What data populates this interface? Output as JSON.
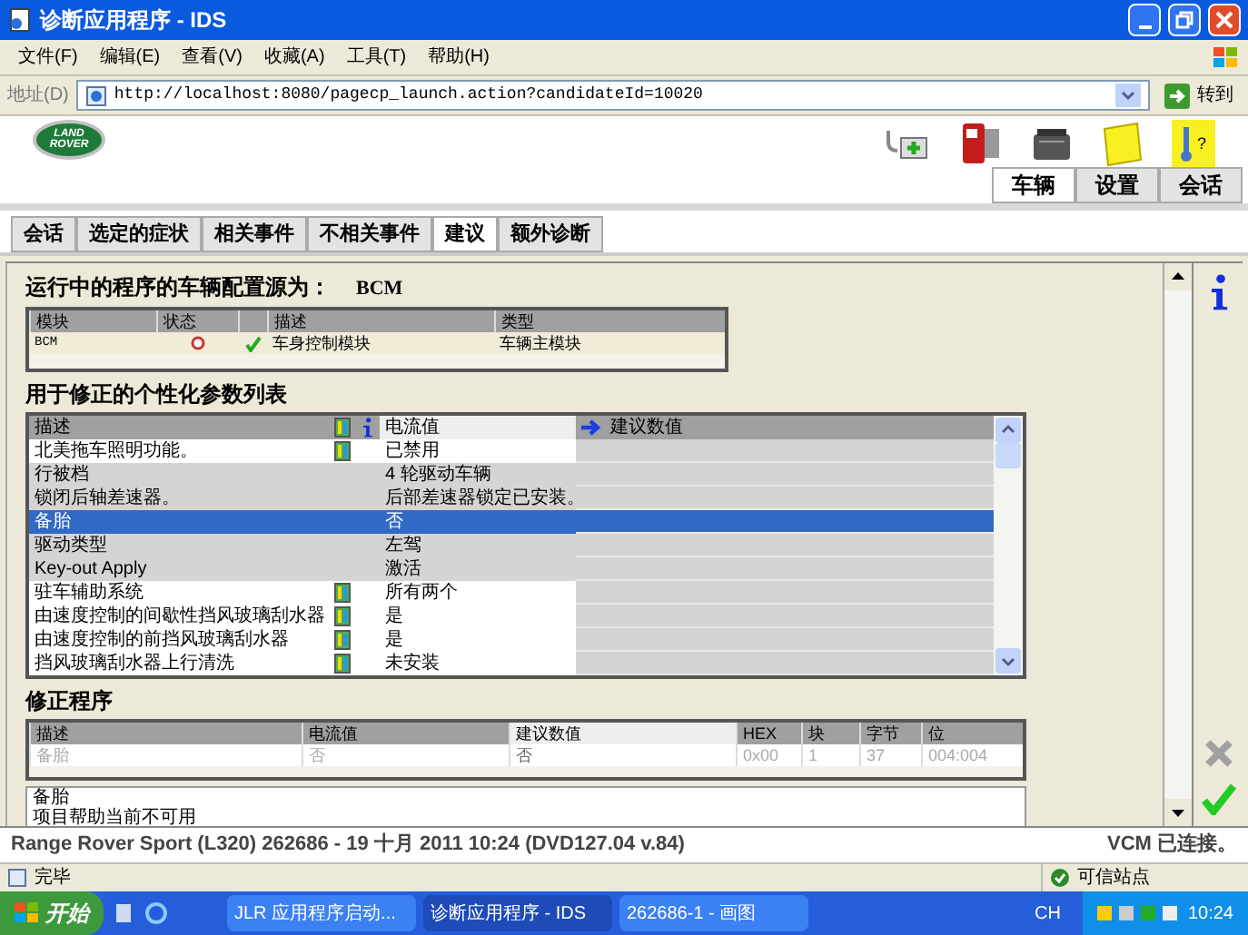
{
  "window": {
    "title": "诊断应用程序 - IDS"
  },
  "menu": [
    "文件(F)",
    "编辑(E)",
    "查看(V)",
    "收藏(A)",
    "工具(T)",
    "帮助(H)"
  ],
  "address": {
    "label": "地址(D)",
    "url": "http://localhost:8080/pagecp_launch.action?candidateId=10020",
    "go": "转到"
  },
  "logo": {
    "text": "LAND ROVER"
  },
  "help_icon_mark": "?",
  "header_tabs": [
    {
      "label": "车辆",
      "selected": true
    },
    {
      "label": "设置",
      "selected": false
    },
    {
      "label": "会话",
      "selected": false
    }
  ],
  "tabs": [
    {
      "label": "会话",
      "selected": false
    },
    {
      "label": "选定的症状",
      "selected": false
    },
    {
      "label": "相关事件",
      "selected": false
    },
    {
      "label": "不相关事件",
      "selected": false
    },
    {
      "label": "建议",
      "selected": true
    },
    {
      "label": "额外诊断",
      "selected": false
    }
  ],
  "config": {
    "title": "运行中的程序的车辆配置源为：",
    "source": "BCM",
    "columns": [
      "模块",
      "状态",
      "描述",
      "类型"
    ],
    "rows": [
      {
        "module": "BCM",
        "ok": true,
        "description": "车身控制模块",
        "type": "车辆主模块"
      }
    ]
  },
  "params": {
    "title": "用于修正的个性化参数列表",
    "columns": [
      "描述",
      "电流值",
      "建议数值"
    ],
    "rows": [
      {
        "description": "北美拖车照明功能。",
        "configurable": true,
        "current": "已禁用",
        "selected": false
      },
      {
        "description": "行被档",
        "configurable": false,
        "current": "4 轮驱动车辆",
        "selected": false
      },
      {
        "description": "锁闭后轴差速器。",
        "configurable": false,
        "current": "后部差速器锁定已安装。",
        "selected": false
      },
      {
        "description": "备胎",
        "configurable": false,
        "current": "否",
        "selected": true
      },
      {
        "description": "驱动类型",
        "configurable": false,
        "current": "左驾",
        "selected": false
      },
      {
        "description": "Key-out Apply",
        "configurable": false,
        "current": "激活",
        "selected": false
      },
      {
        "description": "驻车辅助系统",
        "configurable": true,
        "current": "所有两个",
        "selected": false
      },
      {
        "description": "由速度控制的间歇性挡风玻璃刮水器",
        "configurable": true,
        "current": "是",
        "selected": false
      },
      {
        "description": "由速度控制的前挡风玻璃刮水器",
        "configurable": true,
        "current": "是",
        "selected": false
      },
      {
        "description": "挡风玻璃刮水器上行清洗",
        "configurable": true,
        "current": "未安装",
        "selected": false
      }
    ]
  },
  "corrections": {
    "title": "修正程序",
    "columns": [
      "描述",
      "电流值",
      "建议数值",
      "HEX",
      "块",
      "字节",
      "位"
    ],
    "rows": [
      [
        "备胎",
        "否",
        "否",
        "0x00",
        "1",
        "37",
        "004:004"
      ]
    ]
  },
  "help": {
    "title": "备胎",
    "text": "项目帮助当前不可用"
  },
  "vehicle_bar": {
    "info": "Range Rover Sport (L320) 262686 - 19 十月  2011 10:24 (DVD127.04 v.84)",
    "vcm": "VCM 已连接。"
  },
  "ie_status": {
    "left": "完毕",
    "zone": "可信站点"
  },
  "taskbar": {
    "start": "开始",
    "items": [
      {
        "label": "JLR 应用程序启动...",
        "selected": false
      },
      {
        "label": "诊断应用程序 - IDS",
        "selected": true
      },
      {
        "label": "262686-1 - 画图",
        "selected": false
      }
    ],
    "lang": "CH",
    "clock": "10:24"
  }
}
